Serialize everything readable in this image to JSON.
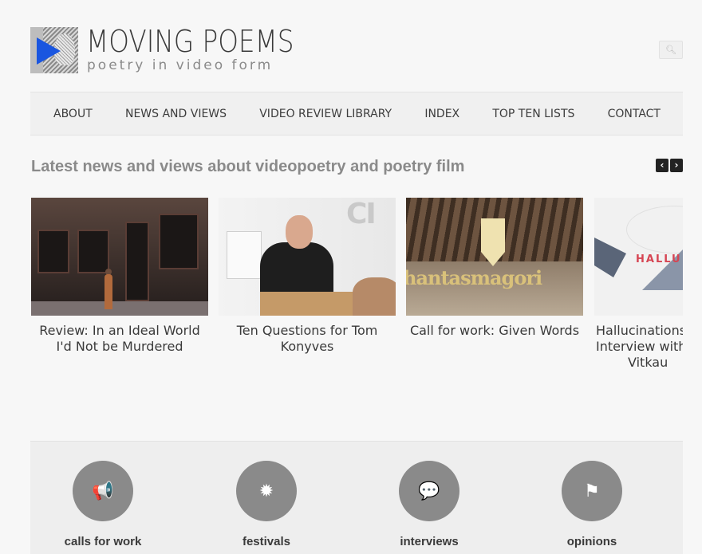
{
  "site": {
    "title": "MOVING POEMS",
    "tagline": "poetry in video form"
  },
  "search": {
    "icon": "search-icon"
  },
  "nav": {
    "items": [
      {
        "label": "ABOUT"
      },
      {
        "label": "NEWS AND VIEWS"
      },
      {
        "label": "VIDEO REVIEW LIBRARY"
      },
      {
        "label": "INDEX"
      },
      {
        "label": "TOP TEN LISTS"
      },
      {
        "label": "CONTACT"
      }
    ]
  },
  "latest": {
    "heading": "Latest news and views about videopoetry and poetry film",
    "prev_label": "‹",
    "next_label": "›",
    "cards": [
      {
        "title": "Review: In an Ideal World I'd Not be Murdered"
      },
      {
        "title": "Ten Questions for Tom Konyves"
      },
      {
        "title": "Call for work: Given Words",
        "thumb_text": "hantasmagori"
      },
      {
        "title_lines": [
          "Hallucinations",
          "Interview with",
          "Vitkau"
        ],
        "thumb_text": "HALLU"
      }
    ]
  },
  "thumb2": {
    "letter": "CI"
  },
  "categories": [
    {
      "label": "calls for work",
      "icon": "megaphone-icon",
      "glyph": "📢"
    },
    {
      "label": "festivals",
      "icon": "sun-icon",
      "glyph": "✹"
    },
    {
      "label": "interviews",
      "icon": "speech-bubbles-icon",
      "glyph": "💬"
    },
    {
      "label": "opinions",
      "icon": "presenter-icon",
      "glyph": "⚑"
    }
  ],
  "colors": {
    "background": "#f7f7f7",
    "accent_play": "#1a56e0",
    "category_circle": "#8a8a8a",
    "heading_gray": "#8a8a8a"
  }
}
